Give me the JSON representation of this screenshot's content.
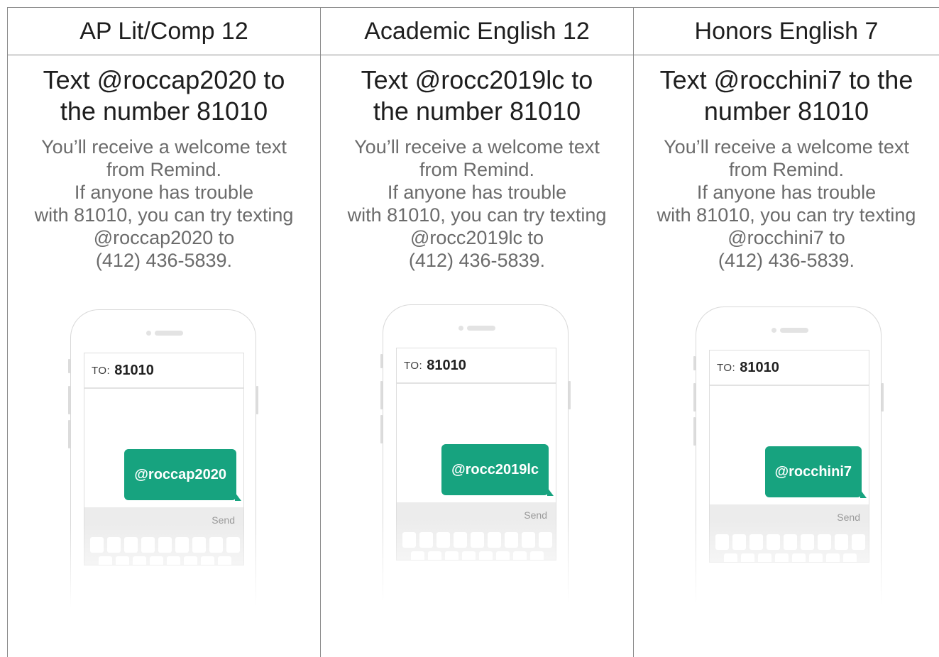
{
  "columns": [
    {
      "header": "AP Lit/Comp 12",
      "instruction_lines": [
        "Text @roccap2020 to",
        "the number 81010"
      ],
      "note_lines": [
        "You’ll receive a welcome text",
        "from Remind.",
        "If anyone has trouble",
        "with 81010, you can try texting",
        "@roccap2020 to",
        "(412) 436-5839."
      ],
      "phone": {
        "to_label": "TO:",
        "to_number": "81010",
        "bubble_text": "@roccap2020",
        "send_label": "Send"
      }
    },
    {
      "header": "Academic English 12",
      "instruction_lines": [
        "Text @rocc2019lc to",
        "the number 81010"
      ],
      "note_lines": [
        "You’ll receive a welcome text",
        "from Remind.",
        "If anyone has trouble",
        "with 81010, you can try texting",
        "@rocc2019lc to",
        "(412) 436-5839."
      ],
      "phone": {
        "to_label": "TO:",
        "to_number": "81010",
        "bubble_text": "@rocc2019lc",
        "send_label": "Send"
      }
    },
    {
      "header": "Honors English 7",
      "instruction_lines": [
        "Text @rocchini7 to the",
        "number 81010"
      ],
      "note_lines": [
        "You’ll receive a welcome text",
        "from Remind.",
        "If anyone has trouble",
        "with 81010, you can try texting",
        "@rocchini7 to",
        "(412) 436-5839."
      ],
      "phone": {
        "to_label": "TO:",
        "to_number": "81010",
        "bubble_text": "@rocchini7",
        "send_label": "Send"
      }
    }
  ],
  "colors": {
    "accent": "#17a37f",
    "grid": "#8a8a8a",
    "note_text": "#6b6b6b"
  }
}
